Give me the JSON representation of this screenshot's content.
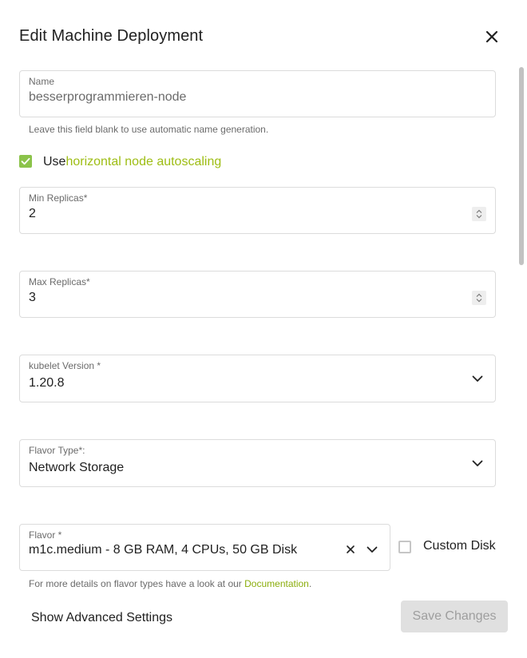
{
  "dialog": {
    "title": "Edit Machine Deployment",
    "close_icon": "close-icon"
  },
  "name_field": {
    "label": "Name",
    "value": "besserprogrammieren-node",
    "hint": "Leave this field blank to use automatic name generation."
  },
  "autoscaling": {
    "checked": true,
    "prefix": "Use",
    "link_text": "horizontal node autoscaling"
  },
  "min_replicas": {
    "label": "Min Replicas*",
    "value": "2"
  },
  "max_replicas": {
    "label": "Max Replicas*",
    "value": "3"
  },
  "kubelet_version": {
    "label": "kubelet Version *",
    "value": "1.20.8"
  },
  "flavor_type": {
    "label": "Flavor Type*:",
    "value": "Network Storage"
  },
  "flavor": {
    "label": "Flavor *",
    "value": "m1c.medium - 8 GB RAM, 4 CPUs, 50 GB Disk",
    "hint_prefix": "For more details on flavor types have a look at our ",
    "hint_link": "Documentation",
    "hint_suffix": "."
  },
  "custom_disk": {
    "label": "Custom Disk",
    "checked": false
  },
  "footer": {
    "advanced_label": "Show Advanced Settings",
    "save_label": "Save Changes",
    "save_disabled": true
  },
  "colors": {
    "accent": "#9ebd14",
    "checkbox_checked": "#8bc34a",
    "border": "#dcdcdc",
    "disabled_bg": "#e0e0e0",
    "disabled_text": "#9e9e9e"
  }
}
